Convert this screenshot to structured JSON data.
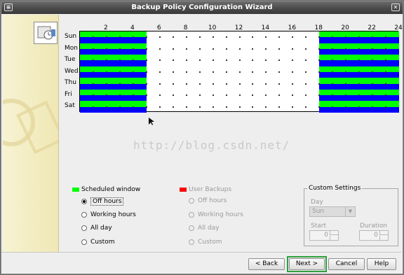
{
  "window": {
    "title": "Backup Policy Configuration Wizard",
    "menu_glyph": "≡",
    "close_glyph": "✕"
  },
  "schedule": {
    "hours": [
      "2",
      "4",
      "6",
      "8",
      "10",
      "12",
      "14",
      "16",
      "18",
      "20",
      "22",
      "24"
    ],
    "days": [
      "Sun",
      "Mon",
      "Tue",
      "Wed",
      "Thu",
      "Fri",
      "Sat"
    ],
    "off_hours_start": 18,
    "off_hours_end": 5
  },
  "legend": {
    "scheduled_window": "Scheduled window",
    "user_backups": "User Backups",
    "scheduled_color": "#00ff00",
    "user_color": "#ff0000"
  },
  "left_options": [
    {
      "label": "Off hours",
      "selected": true
    },
    {
      "label": "Working hours",
      "selected": false
    },
    {
      "label": "All day",
      "selected": false
    },
    {
      "label": "Custom",
      "selected": false
    }
  ],
  "right_options": [
    {
      "label": "Off hours"
    },
    {
      "label": "Working hours"
    },
    {
      "label": "All day"
    },
    {
      "label": "Custom"
    }
  ],
  "custom_settings": {
    "title": "Custom Settings",
    "day_label": "Day",
    "day_value": "Sun",
    "start_label": "Start",
    "start_value": "0",
    "duration_label": "Duration",
    "duration_value": "0"
  },
  "watermark": "http://blog.csdn.net/",
  "buttons": {
    "back": "< Back",
    "next": "Next >",
    "cancel": "Cancel",
    "help": "Help"
  },
  "colors": {
    "blue_band": "#0000ff",
    "green_band": "#00ff00"
  }
}
